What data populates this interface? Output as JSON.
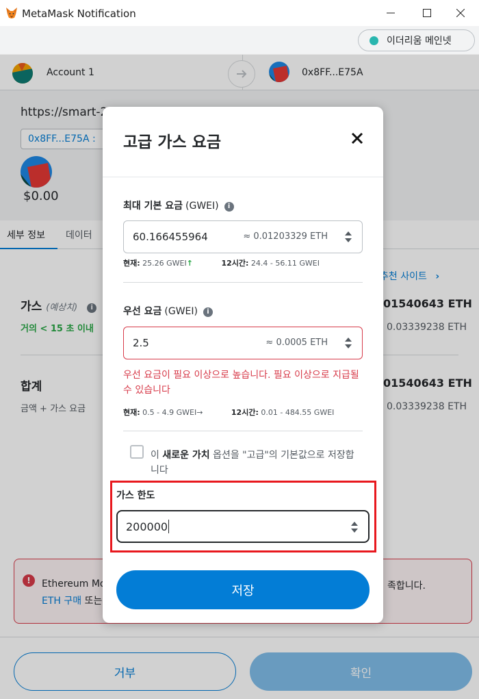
{
  "window": {
    "title": "MetaMask Notification"
  },
  "network": {
    "label": "이더리움 메인넷",
    "dot_color": "#29b6af"
  },
  "sender": {
    "name": "Account 1"
  },
  "recipient": {
    "address": "0x8FF...E75A"
  },
  "origin": {
    "url": "https://smart-2",
    "address_chip": "0x8FF...E75A :",
    "balance": "$0.00"
  },
  "tabs": [
    {
      "label": "세부 정보"
    },
    {
      "label": "데이터"
    }
  ],
  "details": {
    "recommended_link": "추천 사이트",
    "gas_label": "가스",
    "gas_sub": "(예상치)",
    "gas_time": "거의 < 15 초 이내",
    "gas_eth": "01540643 ETH",
    "gas_max": "0.03339238 ETH",
    "total_label": "합계",
    "total_sub": "금액 + 가스 요금",
    "total_eth": "01540643 ETH",
    "total_max": "0.03339238 ETH"
  },
  "warning": {
    "line1": "Ethereum Mo",
    "line2_link": "ETH 구매",
    "line2_rest": " 또는",
    "right": "족합니다."
  },
  "footer": {
    "reject": "거부",
    "confirm": "확인"
  },
  "modal": {
    "title": "고급 가스 요금",
    "max_base": {
      "label": "최대 기본 요금",
      "unit": "(GWEI)",
      "value": "60.166455964",
      "eth": "≈ 0.01203329 ETH",
      "current_label": "현재:",
      "current_value": "25.26 GWEI",
      "range_label": "12시간:",
      "range_value": "24.4 - 56.11 GWEI"
    },
    "priority": {
      "label": "우선 요금",
      "unit": "(GWEI)",
      "value": "2.5",
      "eth": "≈ 0.0005 ETH",
      "error": "우선 요금이 필요 이상으로 높습니다. 필요 이상으로 지급될 수 있습니다",
      "current_label": "현재:",
      "current_value": "0.5 - 4.9 GWEI",
      "range_label": "12시간:",
      "range_value": "0.01 - 484.55 GWEI"
    },
    "checkbox": {
      "prefix": "이 ",
      "bold": "새로운 가치",
      "rest": " 옵션을 \"고급\"의 기본값으로 저장합니다"
    },
    "gas_limit": {
      "label": "가스 한도",
      "value": "200000"
    },
    "save": "저장"
  },
  "colors": {
    "primary": "#037dd6",
    "error": "#d73a49",
    "success": "#28a745",
    "highlight": "#e8181e"
  }
}
